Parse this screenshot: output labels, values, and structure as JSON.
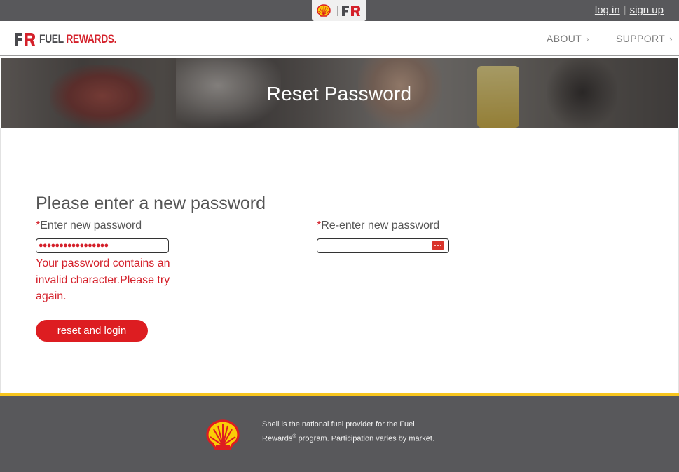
{
  "topbar": {
    "login_label": "log in",
    "separator": "|",
    "signup_label": "sign up"
  },
  "brand": {
    "logo_fuel": "FUEL",
    "logo_rewards": "REWARDS."
  },
  "nav": {
    "items": [
      {
        "label": "ABOUT"
      },
      {
        "label": "SUPPORT"
      }
    ]
  },
  "hero": {
    "title": "Reset Password"
  },
  "form": {
    "heading": "Please enter a new password",
    "required_mark": "*",
    "new_password_label": "Enter new password",
    "new_password_value": "●●●●●●●●●●●●●●●●●",
    "confirm_password_label": "Re-enter new password",
    "confirm_password_value": "",
    "error_message": "Your password contains an invalid character.Please try again.",
    "submit_label": "reset and login"
  },
  "footer": {
    "text_part1": "Shell is the national fuel provider for the Fuel Rewards",
    "text_reg": "®",
    "text_part2": " program. Participation varies by market."
  },
  "colors": {
    "brand_red": "#dd1d21",
    "dark_gray": "#58585b",
    "footer_accent": "#f7c51e"
  },
  "icons": [
    "shell-logo-icon",
    "fuel-rewards-logo-icon",
    "chevron-right-icon",
    "password-manager-icon"
  ]
}
